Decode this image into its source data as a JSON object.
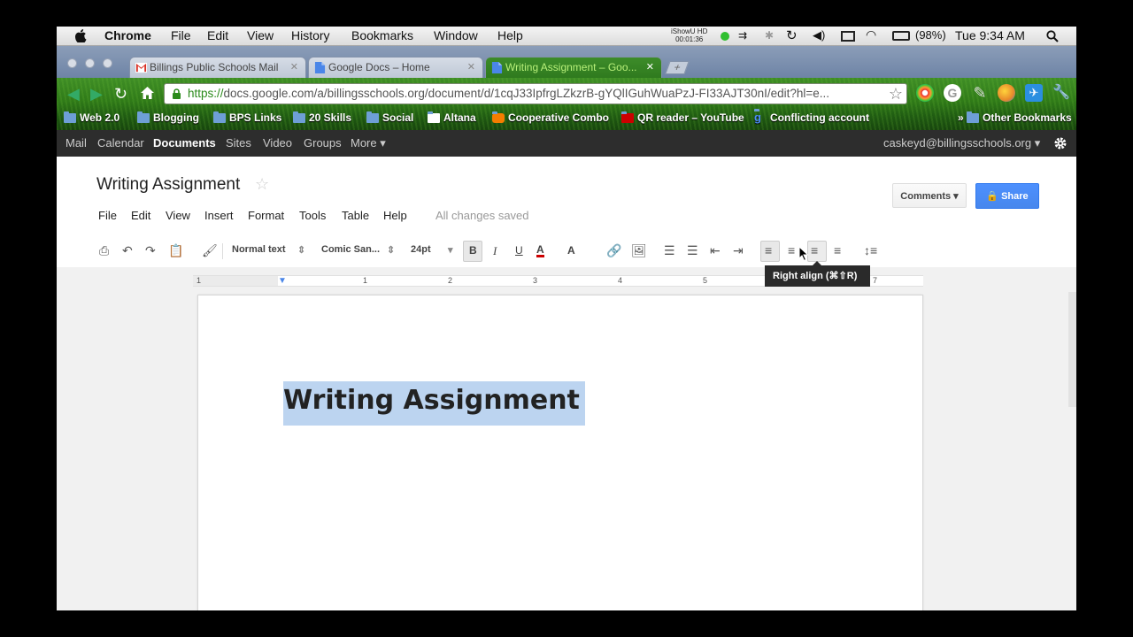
{
  "mac_menubar": {
    "app_name": "Chrome",
    "menus": [
      "File",
      "Edit",
      "View",
      "History",
      "Bookmarks",
      "Window",
      "Help"
    ],
    "ishowu_label": "iShowU HD",
    "ishowu_time": "00:01:36",
    "battery": "(98%)",
    "clock": "Tue 9:34 AM"
  },
  "tabs": [
    {
      "label": "Billings Public Schools Mail",
      "favicon": "gmail-icon"
    },
    {
      "label": "Google Docs – Home",
      "favicon": "docs-icon"
    },
    {
      "label": "Writing Assignment – Goo...",
      "favicon": "docs-icon",
      "active": true
    }
  ],
  "address_bar": {
    "scheme": "https://",
    "url": "docs.google.com/a/billingsschools.org/document/d/1cqJ33IpfrgLZkzrB-gYQlIGuhWuaPzJ-FI33AJT30nI/edit?hl=e..."
  },
  "bookmarks": [
    {
      "label": "Web 2.0",
      "icon": "folder-icon"
    },
    {
      "label": "Blogging",
      "icon": "folder-icon"
    },
    {
      "label": "BPS Links",
      "icon": "folder-icon"
    },
    {
      "label": "20 Skills",
      "icon": "folder-icon"
    },
    {
      "label": "Social",
      "icon": "folder-icon"
    },
    {
      "label": "Altana",
      "icon": "altana-icon"
    },
    {
      "label": "Cooperative Combo",
      "icon": "blogger-icon"
    },
    {
      "label": "QR reader – YouTube",
      "icon": "youtube-icon"
    },
    {
      "label": "Conflicting account",
      "icon": "google-icon"
    },
    {
      "label": "Other Bookmarks",
      "icon": "folder-icon"
    }
  ],
  "google_bar": {
    "items": [
      "Mail",
      "Calendar",
      "Documents",
      "Sites",
      "Video",
      "Groups",
      "More ▾"
    ],
    "selected": "Documents",
    "account": "caskeyd@billingsschools.org ▾"
  },
  "doc": {
    "title": "Writing Assignment",
    "menus": [
      "File",
      "Edit",
      "View",
      "Insert",
      "Format",
      "Tools",
      "Table",
      "Help"
    ],
    "save_status": "All changes saved",
    "comments_label": "Comments ▾",
    "share_label": "Share",
    "body_heading": "Writing Assignment"
  },
  "toolbar": {
    "style": "Normal text",
    "font": "Comic San...",
    "size": "24pt",
    "bold": "B",
    "italic": "I",
    "underline": "U",
    "text_color": "A",
    "highlight": "A"
  },
  "tooltip": "Right align (⌘⇧R)",
  "ruler_numbers": [
    "1",
    "1",
    "2",
    "3",
    "4",
    "5",
    "7"
  ],
  "colors": {
    "share_blue": "#4d90fe",
    "selection": "#bcd4f0",
    "google_bar": "#2d2d2d",
    "text_color_underline": "#cc0000"
  }
}
